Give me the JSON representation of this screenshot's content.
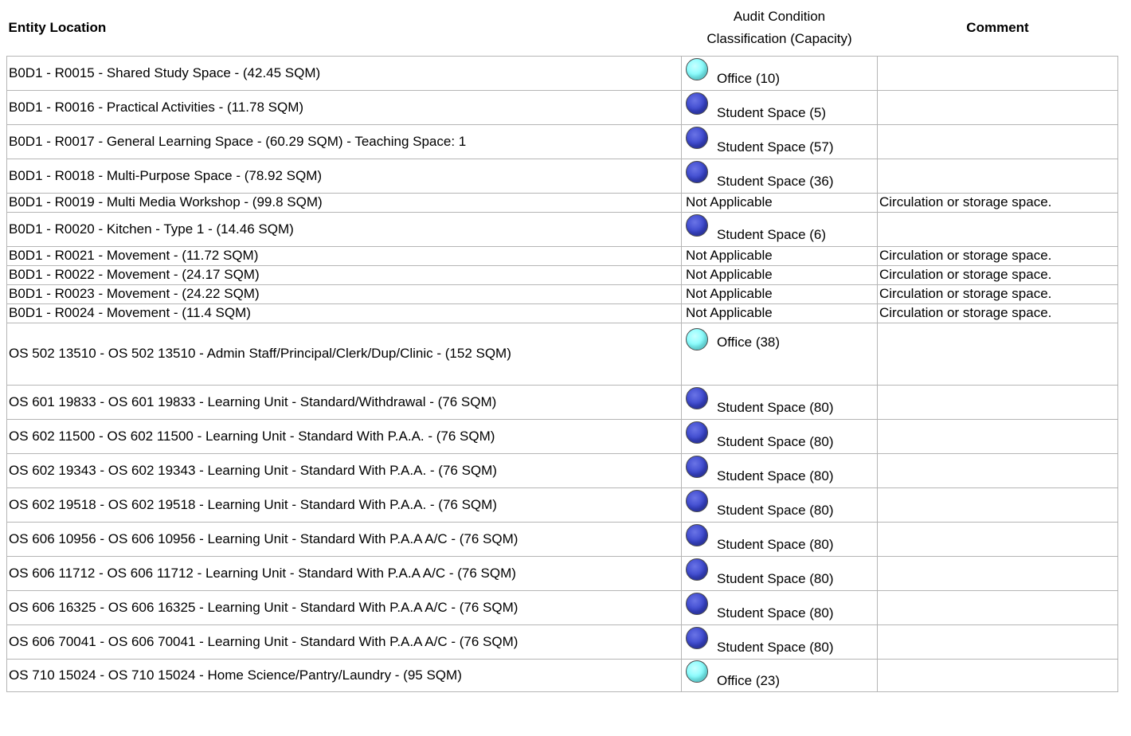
{
  "header": {
    "location_label": "Entity Location",
    "classification_line1": "Audit Condition",
    "classification_line2": "Classification (Capacity)",
    "comment_label": "Comment"
  },
  "colors": {
    "office": "#7ffcfd",
    "student": "#3a46cc",
    "border": "#b5b5b5"
  },
  "rows": [
    {
      "location": "B0D1 - R0015 - Shared Study Space - (42.45 SQM)",
      "indicator": "office",
      "classification": "Office (10)",
      "comment": ""
    },
    {
      "location": "B0D1 - R0016 - Practical Activities - (11.78 SQM)",
      "indicator": "student",
      "classification": "Student Space (5)",
      "comment": ""
    },
    {
      "location": "B0D1 - R0017 - General Learning Space - (60.29 SQM) - Teaching Space: 1",
      "indicator": "student",
      "classification": "Student Space (57)",
      "comment": ""
    },
    {
      "location": "B0D1 - R0018 - Multi-Purpose Space - (78.92 SQM)",
      "indicator": "student",
      "classification": "Student Space (36)",
      "comment": ""
    },
    {
      "location": "B0D1 - R0019 - Multi Media Workshop - (99.8 SQM)",
      "indicator": "none",
      "classification": "Not Applicable",
      "comment": "Circulation or storage space."
    },
    {
      "location": "B0D1 - R0020 - Kitchen - Type 1 - (14.46 SQM)",
      "indicator": "student",
      "classification": "Student Space (6)",
      "comment": ""
    },
    {
      "location": "B0D1 - R0021 - Movement - (11.72 SQM)",
      "indicator": "none",
      "classification": "Not Applicable",
      "comment": "Circulation or storage space."
    },
    {
      "location": "B0D1 - R0022 - Movement - (24.17 SQM)",
      "indicator": "none",
      "classification": "Not Applicable",
      "comment": "Circulation or storage space."
    },
    {
      "location": "B0D1 - R0023 - Movement - (24.22 SQM)",
      "indicator": "none",
      "classification": "Not Applicable",
      "comment": "Circulation or storage space."
    },
    {
      "location": "B0D1 - R0024 - Movement - (11.4 SQM)",
      "indicator": "none",
      "classification": "Not Applicable",
      "comment": "Circulation or storage space."
    },
    {
      "location": "OS 502 13510 - OS 502 13510 - Admin Staff/Principal/Clerk/Dup/Clinic - (152 SQM)",
      "indicator": "office",
      "classification": "Office (38)",
      "comment": ""
    },
    {
      "location": "OS 601 19833 - OS 601 19833 - Learning Unit - Standard/Withdrawal - (76 SQM)",
      "indicator": "student",
      "classification": "Student Space (80)",
      "comment": ""
    },
    {
      "location": "OS 602 11500 - OS 602 11500 - Learning Unit - Standard With P.A.A. - (76 SQM)",
      "indicator": "student",
      "classification": "Student Space (80)",
      "comment": ""
    },
    {
      "location": "OS 602 19343 - OS 602 19343 - Learning Unit - Standard With P.A.A. - (76 SQM)",
      "indicator": "student",
      "classification": "Student Space (80)",
      "comment": ""
    },
    {
      "location": "OS 602 19518 - OS 602 19518 - Learning Unit - Standard With P.A.A. - (76 SQM)",
      "indicator": "student",
      "classification": "Student Space (80)",
      "comment": ""
    },
    {
      "location": "OS 606 10956 - OS 606 10956 - Learning Unit - Standard With P.A.A A/C - (76 SQM)",
      "indicator": "student",
      "classification": "Student Space (80)",
      "comment": ""
    },
    {
      "location": "OS 606 11712 - OS 606 11712 - Learning Unit - Standard With P.A.A A/C - (76 SQM)",
      "indicator": "student",
      "classification": "Student Space (80)",
      "comment": ""
    },
    {
      "location": "OS 606 16325 - OS 606 16325 - Learning Unit - Standard With P.A.A A/C - (76 SQM)",
      "indicator": "student",
      "classification": "Student Space (80)",
      "comment": ""
    },
    {
      "location": "OS 606 70041 - OS 606 70041 - Learning Unit - Standard With P.A.A A/C - (76 SQM)",
      "indicator": "student",
      "classification": "Student Space (80)",
      "comment": ""
    },
    {
      "location": "OS 710 15024 - OS 710 15024 - Home Science/Pantry/Laundry - (95 SQM)",
      "indicator": "office",
      "classification": "Office (23)",
      "comment": ""
    }
  ]
}
